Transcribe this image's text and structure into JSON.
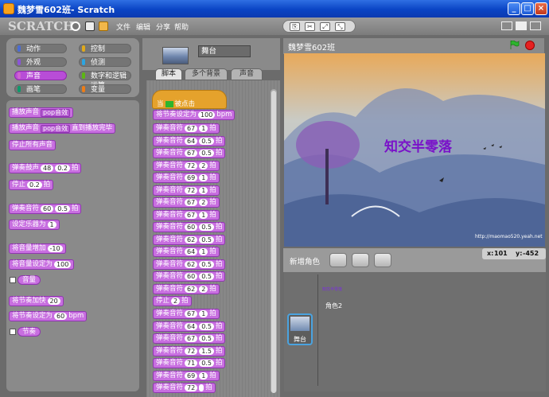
{
  "window": {
    "title": "魏梦雪602班- Scratch",
    "min": "_",
    "max": "□",
    "close": "×"
  },
  "menu": {
    "logo": "SCRATCH",
    "items": [
      "文件",
      "编辑",
      "分享",
      "帮助"
    ]
  },
  "categories": [
    {
      "label": "动作",
      "color": "#4a6cd4"
    },
    {
      "label": "控制",
      "color": "#e1a91a"
    },
    {
      "label": "外观",
      "color": "#8a55d7"
    },
    {
      "label": "侦测",
      "color": "#2ca5e2"
    },
    {
      "label": "声音",
      "color": "#cf63cf"
    },
    {
      "label": "数字和逻辑运算",
      "color": "#5cb712"
    },
    {
      "label": "画笔",
      "color": "#0e9a6c"
    },
    {
      "label": "变量",
      "color": "#ee7d16"
    }
  ],
  "palette": {
    "play_sound": "播放声音",
    "sound_value": "pop音效",
    "play_sound_wait": "播放声音",
    "until_done": "直到播放完毕",
    "stop_all_sounds": "停止所有声音",
    "play_drum": "弹奏鼓声",
    "drum_value": "48",
    "drum_beats": "0.2",
    "beats": "拍",
    "rest": "停止",
    "rest_value": "0.2",
    "play_note": "弹奏音符",
    "note_value": "60",
    "note_beats": "0.5",
    "set_instrument": "设定乐器为",
    "instrument_value": "1",
    "change_volume": "将音量增加",
    "volume_delta": "-10",
    "set_volume": "将音量设定为",
    "volume_value": "100",
    "volume_reporter": "音量",
    "change_tempo": "将节奏加快",
    "tempo_delta": "20",
    "set_tempo": "将节奏设定为",
    "tempo_value": "60",
    "bpm": "bpm",
    "tempo_reporter": "节奏"
  },
  "sprite": {
    "name": "舞台"
  },
  "tabs": [
    "脚本",
    "多个背景",
    "声音"
  ],
  "script": {
    "hat_prefix": "当",
    "hat_suffix": "被点击",
    "tempo_label": "将节奏设定为",
    "tempo_value": "100",
    "tempo_unit": "bpm",
    "note_label": "弹奏音符",
    "beat_unit": "拍",
    "rest_label": "停止",
    "notes": [
      {
        "n": "67",
        "b": "1"
      },
      {
        "n": "64",
        "b": "0.5"
      },
      {
        "n": "67",
        "b": "0.5"
      },
      {
        "n": "72",
        "b": "2"
      },
      {
        "n": "69",
        "b": "1"
      },
      {
        "n": "72",
        "b": "1"
      },
      {
        "n": "67",
        "b": "2"
      },
      {
        "n": "67",
        "b": "1"
      },
      {
        "n": "60",
        "b": "0.5"
      },
      {
        "n": "62",
        "b": "0.5"
      },
      {
        "n": "64",
        "b": "1"
      },
      {
        "n": "62",
        "b": "0.5"
      },
      {
        "n": "60",
        "b": "0.5"
      },
      {
        "n": "62",
        "b": "2"
      }
    ],
    "rest_value": "2",
    "notes2": [
      {
        "n": "67",
        "b": "1"
      },
      {
        "n": "64",
        "b": "0.5"
      },
      {
        "n": "67",
        "b": "0.5"
      },
      {
        "n": "72",
        "b": "1.5"
      },
      {
        "n": "71",
        "b": "0.5"
      },
      {
        "n": "69",
        "b": "1"
      },
      {
        "n": "72",
        "b": ""
      }
    ]
  },
  "stage": {
    "title": "魏梦雪602班",
    "overlay_text": "知交半零落",
    "url": "http://maomao520.yeah.net",
    "x_label": "x:",
    "x_value": "101",
    "y_label": "y:",
    "y_value": "-452"
  },
  "sprites": {
    "new_sprite_label": "新增角色",
    "stage_label": "舞台",
    "sprite2_label": "角色2",
    "sprite2_icon_text": "知交半零落"
  }
}
